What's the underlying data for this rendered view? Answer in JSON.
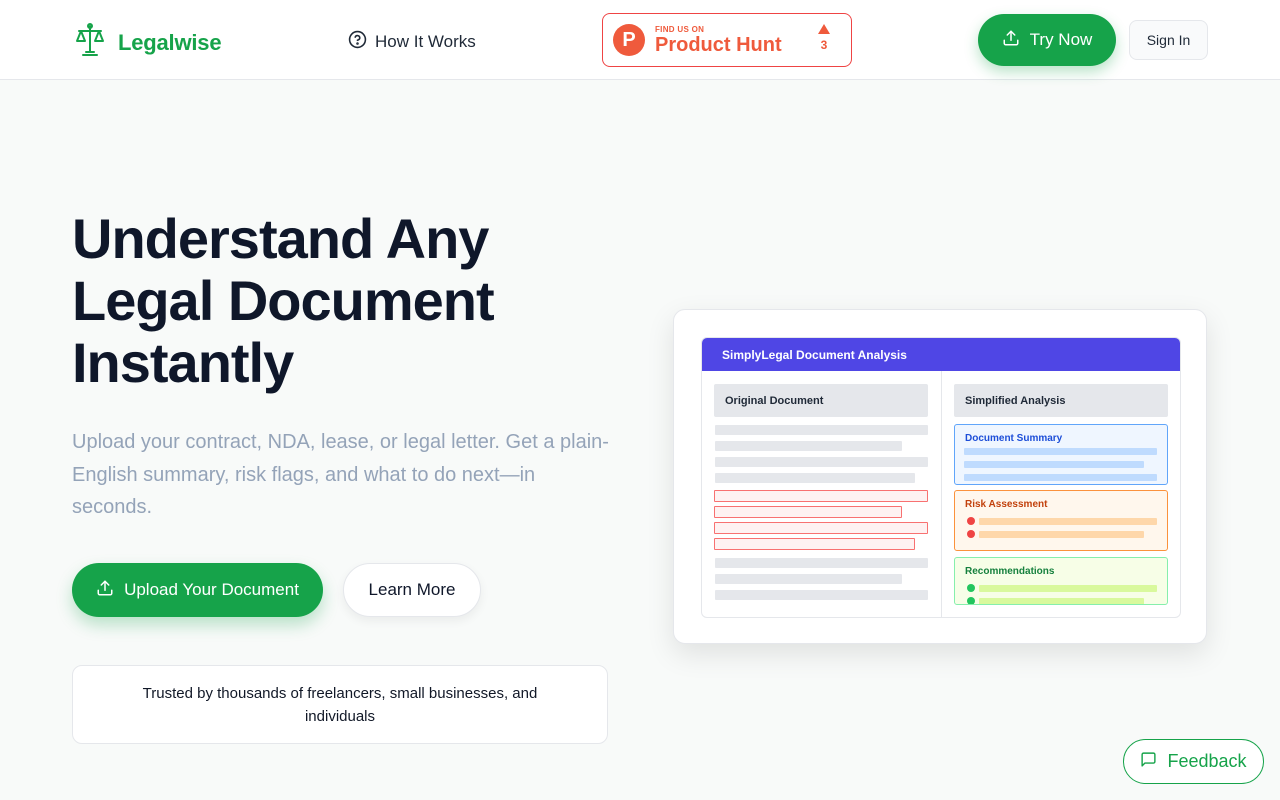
{
  "header": {
    "brand": "Legalwise",
    "nav_how": "How It Works",
    "producthunt": {
      "small": "FIND US ON",
      "big": "Product Hunt",
      "logo_letter": "P",
      "votes": "3"
    },
    "try_now": "Try Now",
    "sign_in": "Sign In"
  },
  "hero": {
    "title": "Understand Any Legal Document Instantly",
    "subtitle": "Upload your contract, NDA, lease, or legal letter. Get a plain-English summary, risk flags, and what to do next—in seconds.",
    "upload_button": "Upload Your Document",
    "learn_button": "Learn More",
    "trusted": "Trusted by thousands of freelancers, small businesses, and individuals"
  },
  "preview": {
    "header": "SimplyLegal Document Analysis",
    "original_title": "Original Document",
    "simplified_title": "Simplified Analysis",
    "summary_title": "Document Summary",
    "risk_title": "Risk Assessment",
    "recommend_title": "Recommendations"
  },
  "feedback": "Feedback",
  "colors": {
    "brand_green": "#16a34a",
    "accent_indigo": "#4f46e5",
    "producthunt": "#ef5a3c"
  }
}
